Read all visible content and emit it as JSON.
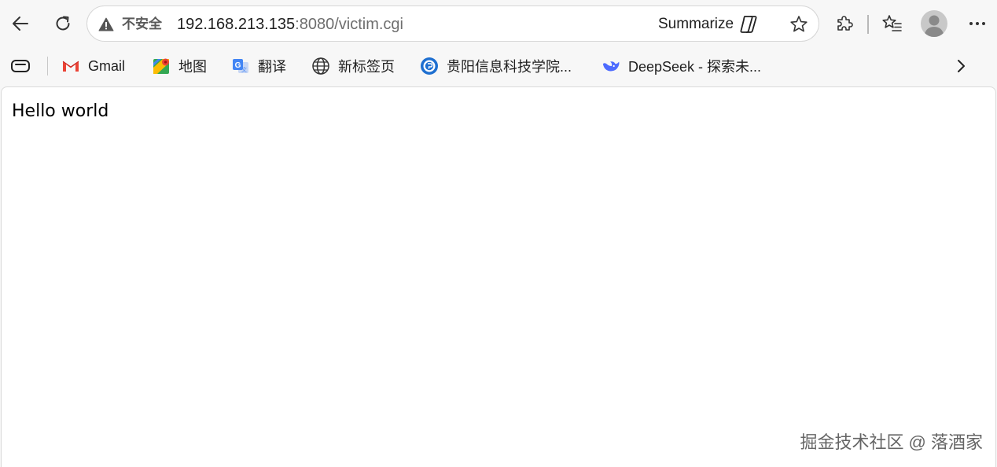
{
  "toolbar": {
    "security_label": "不安全",
    "url_host": "192.168.213.135",
    "url_rest": ":8080/victim.cgi",
    "summarize_label": "Summarize"
  },
  "icons": {
    "back": "back-arrow-icon",
    "reload": "reload-icon",
    "warning": "warning-triangle-icon",
    "summarize": "copilot-icon",
    "star": "star-icon",
    "extensions": "puzzle-piece-icon",
    "favorites": "favorites-icon",
    "profile": "avatar-icon",
    "menu": "ellipsis-icon",
    "bookmarks_toggle": "tab-actions-icon",
    "more": "chevron-right-icon"
  },
  "bookmarks": [
    {
      "label": "Gmail",
      "icon": "gmail-icon"
    },
    {
      "label": "地图",
      "icon": "maps-icon"
    },
    {
      "label": "翻译",
      "icon": "translate-icon"
    },
    {
      "label": "新标签页",
      "icon": "globe-icon"
    },
    {
      "label": "贵阳信息科技学院...",
      "icon": "school-icon"
    },
    {
      "label": "DeepSeek - 探索未...",
      "icon": "deepseek-icon"
    }
  ],
  "page": {
    "body_text": "Hello world",
    "watermark": "掘金技术社区 @ 落酒家"
  },
  "colors": {
    "chrome_bg": "#f7f7f7",
    "content_bg": "#ffffff",
    "gmail_red": "#ea4335",
    "translate_blue": "#4285f4",
    "deepseek_blue": "#4d6bfe"
  }
}
